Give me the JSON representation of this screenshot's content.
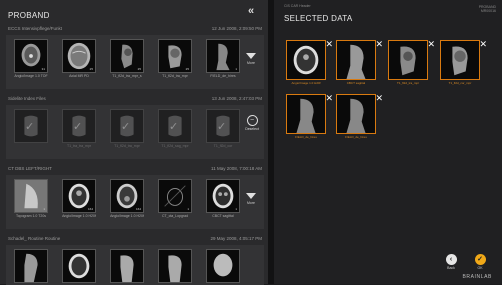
{
  "left_panel": {
    "title": "PROBAND",
    "collapse_glyph": "«",
    "more_label": "More",
    "deselect_label": "Deselect",
    "studies": [
      {
        "name": "ECCS Intensivpflege/Funkt",
        "date": "12 Jun 2008, 2:09:50 PM",
        "dimmed": false,
        "series": [
          {
            "caption": "Angio/Image 1.0 TOF",
            "count": "31"
          },
          {
            "caption": "Axial MR PD",
            "count": "25"
          },
          {
            "caption": "T1_fl2d_tra_mpr_s",
            "count": "25"
          },
          {
            "caption": "T1_fl2d_tra_mpr",
            "count": "25"
          },
          {
            "caption": "FIELD_de_hires",
            "count": "1"
          }
        ]
      },
      {
        "name": "Sidelite Index Files",
        "date": "13 Jun 2008, 2:47:03 PM",
        "dimmed": true,
        "series": [
          {
            "caption": "",
            "count": ""
          },
          {
            "caption": "T1_tra_tra_mpr",
            "count": ""
          },
          {
            "caption": "T1_fl2d_tra_mpr",
            "count": ""
          },
          {
            "caption": "T1_fl2d_sag_mpr",
            "count": ""
          },
          {
            "caption": "T1_fl2d_cor",
            "count": ""
          }
        ]
      },
      {
        "name": "CT DBS LEFT/RIGHT",
        "date": "11 May 2008, 7:00:18 AM",
        "dimmed": false,
        "series": [
          {
            "caption": "Topogram 1.0 T20s",
            "count": "1"
          },
          {
            "caption": "Angio/Image 1.0 H20f",
            "count": "164"
          },
          {
            "caption": "Angio/Image 1.0 H20f",
            "count": "164"
          },
          {
            "caption": "CT_cta_Lopgrad",
            "count": "1"
          },
          {
            "caption": "CBCT sagittal",
            "count": "1"
          }
        ]
      },
      {
        "name": "Schadel_ Routine Routine",
        "date": "29 May 2008, 4:05:17 PM",
        "dimmed": false,
        "series": [
          {
            "caption": "",
            "count": ""
          },
          {
            "caption": "",
            "count": ""
          },
          {
            "caption": "",
            "count": ""
          },
          {
            "caption": "",
            "count": ""
          },
          {
            "caption": "",
            "count": ""
          }
        ]
      }
    ]
  },
  "right_panel": {
    "top_label": "CIS CAR Header",
    "title": "SELECTED DATA",
    "patient_line1": "PROBAND",
    "patient_line2": "MR00016",
    "selected": [
      {
        "caption": "Angio/Image 1.0 H20f"
      },
      {
        "caption": "CBCT sagittal"
      },
      {
        "caption": "T1_fl2d_tra_mpr"
      },
      {
        "caption": "T1_fl2d_cor_mpr"
      },
      {
        "caption": "FIELD_de_hires"
      },
      {
        "caption": "FIELD_de_hires"
      }
    ],
    "back_label": "Back",
    "ok_label": "OK",
    "brand": "BRAINLAB"
  }
}
